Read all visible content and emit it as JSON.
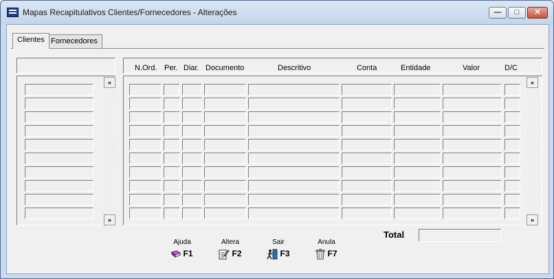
{
  "window": {
    "title": "Mapas Recapitulativos Clientes/Fornecedores - Alterações",
    "min_glyph": "—",
    "max_glyph": "□",
    "close_glyph": "✕"
  },
  "tabs": [
    {
      "label": "Clientes",
      "active": true
    },
    {
      "label": "Fornecedores",
      "active": false
    }
  ],
  "columns": [
    "N.Ord.",
    "Per.",
    "Diar.",
    "Documento",
    "Descritivo",
    "Conta",
    "Entidade",
    "Valor",
    "D/C"
  ],
  "rows_count": 10,
  "scroll": {
    "up_glyph": "«",
    "down_glyph": "»"
  },
  "total": {
    "label": "Total",
    "value": ""
  },
  "function_keys": [
    {
      "label": "Ajuda",
      "key": "F1",
      "icon": "book-icon"
    },
    {
      "label": "Altera",
      "key": "F2",
      "icon": "edit-icon"
    },
    {
      "label": "Sair",
      "key": "F3",
      "icon": "exit-icon"
    },
    {
      "label": "Anula",
      "key": "F7",
      "icon": "trash-icon"
    }
  ]
}
